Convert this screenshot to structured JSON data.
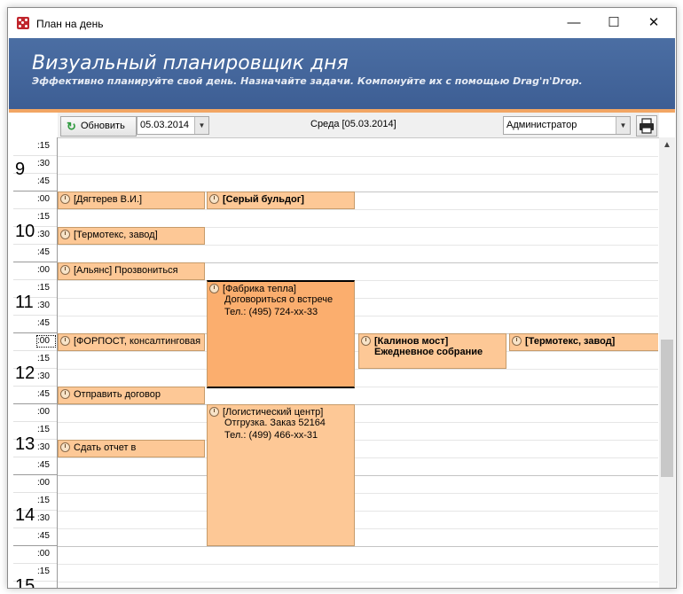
{
  "window": {
    "title": "План на день",
    "controls": {
      "minimize": "—",
      "maximize": "☐",
      "close": "✕"
    }
  },
  "banner": {
    "title": "Визуальный планировщик дня",
    "subtitle": "Эффективно планируйте свой день. Назначайте задачи. Компонуйте их с помощью Drag'n'Drop."
  },
  "toolbar": {
    "refresh_label": "Обновить",
    "date_value": "05.03.2014",
    "day_label": "Среда [05.03.2014]",
    "user_value": "Администратор"
  },
  "timeline": {
    "hours": [
      "9",
      "10",
      "11",
      "12",
      "13",
      "14",
      "15"
    ],
    "minute_labels": [
      ":15",
      ":30",
      ":45",
      ":00",
      ":15",
      ":30",
      ":45",
      ":00",
      ":15",
      ":30",
      ":45",
      ":00",
      ":15",
      ":30",
      ":45",
      ":00",
      ":15",
      ":30",
      ":45",
      ":00",
      ":15",
      ":30",
      ":45",
      ":00",
      ":15"
    ]
  },
  "events": {
    "e1": {
      "line1": "[Дягтерев В.И.]"
    },
    "e2": {
      "line1": "[Серый бульдог]"
    },
    "e3": {
      "line1": "[Термотекс, завод]"
    },
    "e4": {
      "line1": "[Альянс] Прозвониться"
    },
    "e5": {
      "line1": "[Фабрика тепла]",
      "line2": "Договориться о встрече",
      "line3": "Тел.: (495) 724-xx-33"
    },
    "e6": {
      "line1": "[ФОРПОСТ, консалтинговая"
    },
    "e7": {
      "line1": "[Калинов мост]",
      "line2": "Ежедневное собрание"
    },
    "e8": {
      "line1": "[Термотекс, завод]"
    },
    "e9": {
      "line1": "Отправить договор"
    },
    "e10": {
      "line1": "[Логистический центр]",
      "line2": "Отгрузка. Заказ 52164",
      "line3": "Тел.: (499) 466-xx-31"
    },
    "e11": {
      "line1": "Сдать отчет в"
    }
  },
  "colors": {
    "banner": "#44659a",
    "accent": "#f2a664",
    "event": "#fdc896",
    "event_selected": "#fbae6e"
  }
}
